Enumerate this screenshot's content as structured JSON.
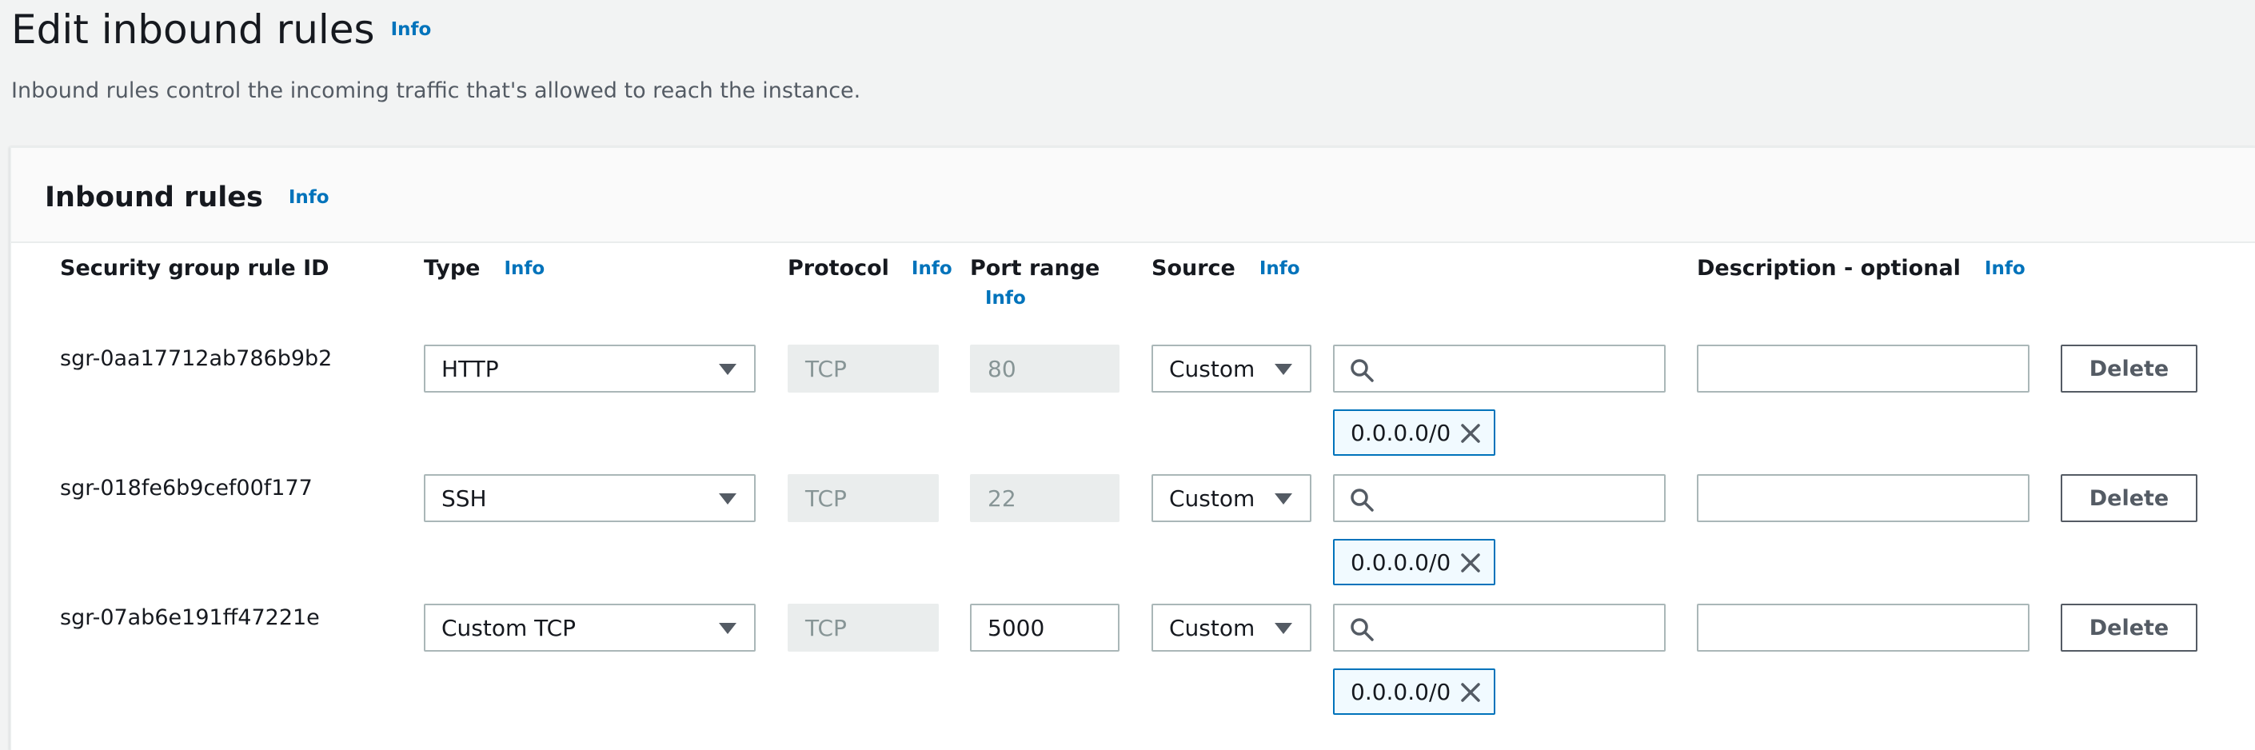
{
  "page": {
    "title": "Edit inbound rules",
    "title_info": "Info",
    "description": "Inbound rules control the incoming traffic that's allowed to reach the instance."
  },
  "panel": {
    "title": "Inbound rules",
    "info": "Info"
  },
  "columns": {
    "rule_id": "Security group rule ID",
    "type": "Type",
    "type_info": "Info",
    "protocol": "Protocol",
    "protocol_info": "Info",
    "port_range": "Port range",
    "port_range_info": "Info",
    "source": "Source",
    "source_info": "Info",
    "description": "Description - optional",
    "description_info": "Info"
  },
  "rows": [
    {
      "rule_id": "sgr-0aa17712ab786b9b2",
      "type": "HTTP",
      "protocol": "TCP",
      "port_range": "80",
      "port_editable": false,
      "source_type": "Custom",
      "search_value": "",
      "cidr": "0.0.0.0/0",
      "description_value": "",
      "delete_label": "Delete"
    },
    {
      "rule_id": "sgr-018fe6b9cef00f177",
      "type": "SSH",
      "protocol": "TCP",
      "port_range": "22",
      "port_editable": false,
      "source_type": "Custom",
      "search_value": "",
      "cidr": "0.0.0.0/0",
      "description_value": "",
      "delete_label": "Delete"
    },
    {
      "rule_id": "sgr-07ab6e191ff47221e",
      "type": "Custom TCP",
      "protocol": "TCP",
      "port_range": "5000",
      "port_editable": true,
      "source_type": "Custom",
      "search_value": "",
      "cidr": "0.0.0.0/0",
      "description_value": "",
      "delete_label": "Delete"
    }
  ],
  "icons": {
    "search": "search-icon",
    "remove": "close-icon",
    "dropdown": "caret-down-icon"
  },
  "colors": {
    "link": "#0073bb",
    "token_border": "#0073bb",
    "token_bg": "#f1faff",
    "page_bg": "#f2f3f3"
  }
}
